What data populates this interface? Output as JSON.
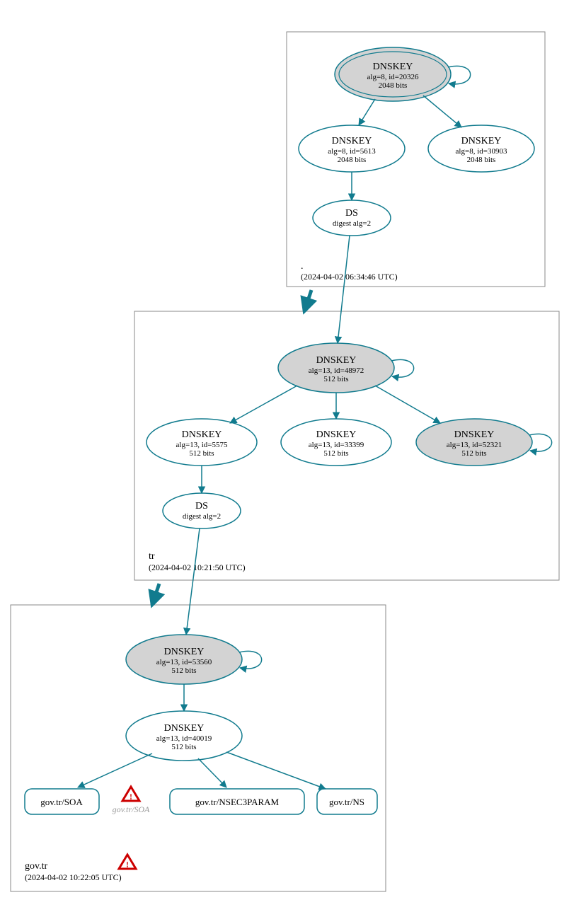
{
  "zones": {
    "root": {
      "label": ".",
      "timestamp": "(2024-04-02 06:34:46 UTC)"
    },
    "tr": {
      "label": "tr",
      "timestamp": "(2024-04-02 10:21:50 UTC)"
    },
    "govtr": {
      "label": "gov.tr",
      "timestamp": "(2024-04-02 10:22:05 UTC)"
    }
  },
  "nodes": {
    "root_ksk": {
      "title": "DNSKEY",
      "line1": "alg=8, id=20326",
      "line2": "2048 bits"
    },
    "root_zsk1": {
      "title": "DNSKEY",
      "line1": "alg=8, id=5613",
      "line2": "2048 bits"
    },
    "root_zsk2": {
      "title": "DNSKEY",
      "line1": "alg=8, id=30903",
      "line2": "2048 bits"
    },
    "root_ds": {
      "title": "DS",
      "line1": "digest alg=2"
    },
    "tr_ksk": {
      "title": "DNSKEY",
      "line1": "alg=13, id=48972",
      "line2": "512 bits"
    },
    "tr_k1": {
      "title": "DNSKEY",
      "line1": "alg=13, id=5575",
      "line2": "512 bits"
    },
    "tr_k2": {
      "title": "DNSKEY",
      "line1": "alg=13, id=33399",
      "line2": "512 bits"
    },
    "tr_k3": {
      "title": "DNSKEY",
      "line1": "alg=13, id=52321",
      "line2": "512 bits"
    },
    "tr_ds": {
      "title": "DS",
      "line1": "digest alg=2"
    },
    "govtr_ksk": {
      "title": "DNSKEY",
      "line1": "alg=13, id=53560",
      "line2": "512 bits"
    },
    "govtr_zsk": {
      "title": "DNSKEY",
      "line1": "alg=13, id=40019",
      "line2": "512 bits"
    },
    "govtr_soa": {
      "label": "gov.tr/SOA"
    },
    "govtr_nsec3": {
      "label": "gov.tr/NSEC3PARAM"
    },
    "govtr_ns": {
      "label": "gov.tr/NS"
    },
    "govtr_soa_w": {
      "label": "gov.tr/SOA"
    }
  }
}
